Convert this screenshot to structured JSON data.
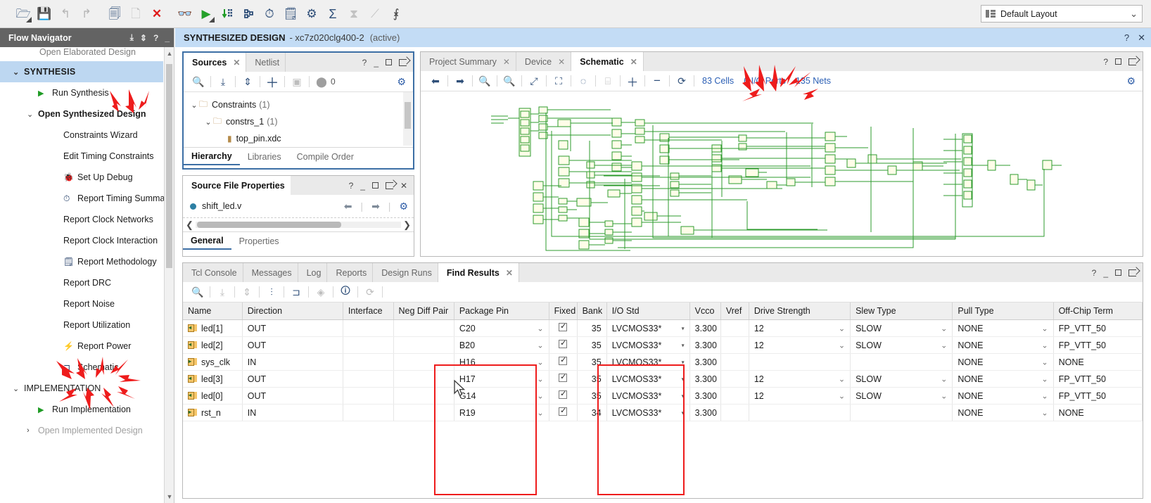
{
  "toolbar": {
    "icons": [
      {
        "name": "open-project-icon",
        "glyph": "὜0",
        "cls": "tb-ico",
        "char": "▱"
      },
      {
        "name": "save-icon"
      },
      {
        "name": "undo-icon"
      },
      {
        "name": "redo-icon"
      },
      {
        "name": "copy-icon"
      },
      {
        "name": "paste-icon"
      },
      {
        "name": "delete-icon"
      },
      {
        "name": "search-icon"
      },
      {
        "name": "run-icon"
      },
      {
        "name": "run-synthesis-icon"
      },
      {
        "name": "schematic-icon"
      },
      {
        "name": "timer-icon"
      },
      {
        "name": "report-methodology-icon"
      },
      {
        "name": "settings-gear-icon"
      },
      {
        "name": "sum-sigma-icon"
      },
      {
        "name": "no-timing-icon"
      },
      {
        "name": "no-highlight-icon"
      },
      {
        "name": "unmark-icon"
      }
    ],
    "layout_label": "Default Layout"
  },
  "flow_navigator": {
    "title": "Flow Navigator",
    "cut_item": "Open Elaborated Design",
    "items": [
      {
        "label": "SYNTHESIS",
        "type": "section",
        "indent": 1,
        "twisty": "⌄"
      },
      {
        "label": "Run Synthesis",
        "indent": 2,
        "icon": "play",
        "twisty": ""
      },
      {
        "label": "Open Synthesized Design",
        "indent": 2,
        "bold": true,
        "twisty": "⌄"
      },
      {
        "label": "Constraints Wizard",
        "indent": 3
      },
      {
        "label": "Edit Timing Constraints",
        "indent": 3
      },
      {
        "label": "Set Up Debug",
        "indent": 3,
        "icon": "debug"
      },
      {
        "label": "Report Timing Summary",
        "indent": 3,
        "icon": "timer"
      },
      {
        "label": "Report Clock Networks",
        "indent": 3
      },
      {
        "label": "Report Clock Interaction",
        "indent": 3
      },
      {
        "label": "Report Methodology",
        "indent": 3,
        "icon": "clipboard"
      },
      {
        "label": "Report DRC",
        "indent": 3
      },
      {
        "label": "Report Noise",
        "indent": 3
      },
      {
        "label": "Report Utilization",
        "indent": 3
      },
      {
        "label": "Report Power",
        "indent": 3,
        "icon": "power"
      },
      {
        "label": "Schematic",
        "indent": 3,
        "icon": "schem"
      },
      {
        "label": "IMPLEMENTATION",
        "type": "group",
        "indent": 1,
        "twisty": "⌄"
      },
      {
        "label": "Run Implementation",
        "indent": 2,
        "icon": "play"
      },
      {
        "label": "Open Implemented Design",
        "indent": 2,
        "dim": true,
        "twisty": "›"
      }
    ]
  },
  "design_bar": {
    "title": "SYNTHESIZED DESIGN",
    "part": "- xc7z020clg400-2",
    "state": "(active)",
    "help": "?",
    "close": "✕"
  },
  "sources_panel": {
    "tabs": [
      {
        "label": "Sources",
        "active": true,
        "closable": true
      },
      {
        "label": "Netlist",
        "active": false,
        "closable": false
      }
    ],
    "badge_count": "0",
    "tree": [
      {
        "label": "Constraints",
        "count": "(1)",
        "indent": 0,
        "twisty": "⌄",
        "folder": true
      },
      {
        "label": "constrs_1",
        "count": "(1)",
        "indent": 1,
        "twisty": "⌄",
        "folder": true
      },
      {
        "label": "top_pin.xdc",
        "count": "",
        "indent": 2,
        "twisty": "",
        "folder": false
      }
    ],
    "subtabs": [
      {
        "label": "Hierarchy",
        "active": true
      },
      {
        "label": "Libraries",
        "active": false
      },
      {
        "label": "Compile Order",
        "active": false
      }
    ]
  },
  "source_file_properties": {
    "title": "Source File Properties",
    "file_name": "shift_led.v",
    "subtabs": [
      {
        "label": "General",
        "active": true
      },
      {
        "label": "Properties",
        "active": false
      }
    ]
  },
  "schematic_panel": {
    "tabs": [
      {
        "label": "Project Summary",
        "active": false,
        "closable": true
      },
      {
        "label": "Device",
        "active": false,
        "closable": true
      },
      {
        "label": "Schematic",
        "active": true,
        "closable": true
      }
    ],
    "stats": [
      {
        "label": "83 Cells"
      },
      {
        "label": "6 I/O Ports"
      },
      {
        "label": "135 Nets"
      }
    ]
  },
  "results_panel": {
    "tabs": [
      {
        "label": "Tcl Console",
        "active": false
      },
      {
        "label": "Messages",
        "active": false
      },
      {
        "label": "Log",
        "active": false
      },
      {
        "label": "Reports",
        "active": false
      },
      {
        "label": "Design Runs",
        "active": false
      },
      {
        "label": "Find Results",
        "active": true,
        "closable": true
      }
    ],
    "columns": [
      "Name",
      "Direction",
      "Interface",
      "Neg Diff Pair",
      "Package Pin",
      "Fixed",
      "Bank",
      "I/O Std",
      "Vcco",
      "Vref",
      "Drive Strength",
      "Slew Type",
      "Pull Type",
      "Off-Chip Term"
    ],
    "rows": [
      {
        "name": "led[1]",
        "dir": "OUT",
        "interface": "",
        "neg_diff": "",
        "package_pin": "C20",
        "fixed": true,
        "bank": "35",
        "io_std": "LVCMOS33*",
        "vcco": "3.300",
        "vref": "",
        "drive": "12",
        "slew": "SLOW",
        "pull": "NONE",
        "offchip": "FP_VTT_50",
        "icon": "out"
      },
      {
        "name": "led[2]",
        "dir": "OUT",
        "interface": "",
        "neg_diff": "",
        "package_pin": "B20",
        "fixed": true,
        "bank": "35",
        "io_std": "LVCMOS33*",
        "vcco": "3.300",
        "vref": "",
        "drive": "12",
        "slew": "SLOW",
        "pull": "NONE",
        "offchip": "FP_VTT_50",
        "icon": "out"
      },
      {
        "name": "sys_clk",
        "dir": "IN",
        "interface": "",
        "neg_diff": "",
        "package_pin": "H16",
        "fixed": true,
        "bank": "35",
        "io_std": "LVCMOS33*",
        "vcco": "3.300",
        "vref": "",
        "drive": "",
        "slew": "",
        "pull": "NONE",
        "offchip": "NONE",
        "icon": "in"
      },
      {
        "name": "led[3]",
        "dir": "OUT",
        "interface": "",
        "neg_diff": "",
        "package_pin": "H17",
        "fixed": true,
        "bank": "35",
        "io_std": "LVCMOS33*",
        "vcco": "3.300",
        "vref": "",
        "drive": "12",
        "slew": "SLOW",
        "pull": "NONE",
        "offchip": "FP_VTT_50",
        "icon": "out"
      },
      {
        "name": "led[0]",
        "dir": "OUT",
        "interface": "",
        "neg_diff": "",
        "package_pin": "G14",
        "fixed": true,
        "bank": "35",
        "io_std": "LVCMOS33*",
        "vcco": "3.300",
        "vref": "",
        "drive": "12",
        "slew": "SLOW",
        "pull": "NONE",
        "offchip": "FP_VTT_50",
        "icon": "out"
      },
      {
        "name": "rst_n",
        "dir": "IN",
        "interface": "",
        "neg_diff": "",
        "package_pin": "R19",
        "fixed": true,
        "bank": "34",
        "io_std": "LVCMOS33*",
        "vcco": "3.300",
        "vref": "",
        "drive": "",
        "slew": "",
        "pull": "NONE",
        "offchip": "NONE",
        "icon": "in"
      }
    ]
  },
  "annotations": {
    "highlight_color": "#ee1c1c",
    "boxes": [
      {
        "target": "package-pin-column"
      },
      {
        "target": "io-std-column"
      }
    ],
    "arrow_clusters": [
      {
        "target": "open-synthesized-design"
      },
      {
        "target": "schematic-nav-item"
      },
      {
        "target": "io-ports-stat"
      }
    ]
  },
  "colors": {
    "accent_blue": "#3d6fa5",
    "title_bar_blue": "#c3dcf5",
    "nav_header_gray": "#636363",
    "link_blue": "#2b5fb5",
    "schematic_green": "#1f8a1f"
  }
}
